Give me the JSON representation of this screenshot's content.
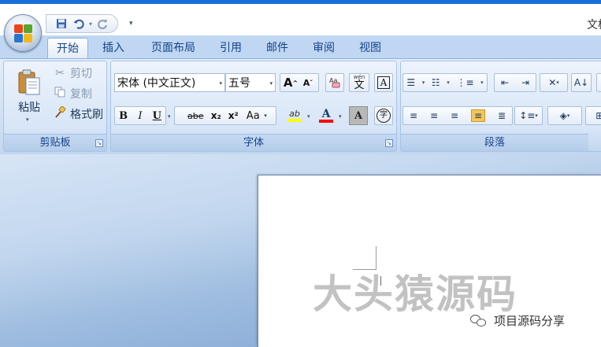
{
  "window": {
    "title": "文档"
  },
  "quick_access": {
    "save_icon": "save-icon",
    "undo_icon": "undo-icon",
    "redo_icon": "redo-icon",
    "more": "▾"
  },
  "tabs": [
    {
      "label": "开始",
      "active": true
    },
    {
      "label": "插入"
    },
    {
      "label": "页面布局"
    },
    {
      "label": "引用"
    },
    {
      "label": "邮件"
    },
    {
      "label": "审阅"
    },
    {
      "label": "视图"
    }
  ],
  "clipboard": {
    "group_label": "剪贴板",
    "paste": "粘贴",
    "cut": "剪切",
    "copy": "复制",
    "format_painter": "格式刷"
  },
  "font": {
    "group_label": "字体",
    "font_name": "宋体 (中文正文)",
    "font_size": "五号",
    "grow": "A",
    "shrink": "A",
    "bold": "B",
    "italic": "I",
    "underline": "U",
    "strike": "abe",
    "subscript": "x₂",
    "superscript": "x²",
    "change_case": "Aa",
    "highlight": "ab",
    "font_color": "A",
    "shade": "A",
    "phonetic": "wén",
    "phonetic_char": "文",
    "border_char": "A",
    "enclose_char": "字",
    "colors": {
      "highlight": "#ffff00",
      "font_color": "#ff0000"
    }
  },
  "paragraph": {
    "group_label": "段落"
  },
  "document": {
    "watermark": "大头猿源码",
    "account": "项目源码分享"
  }
}
